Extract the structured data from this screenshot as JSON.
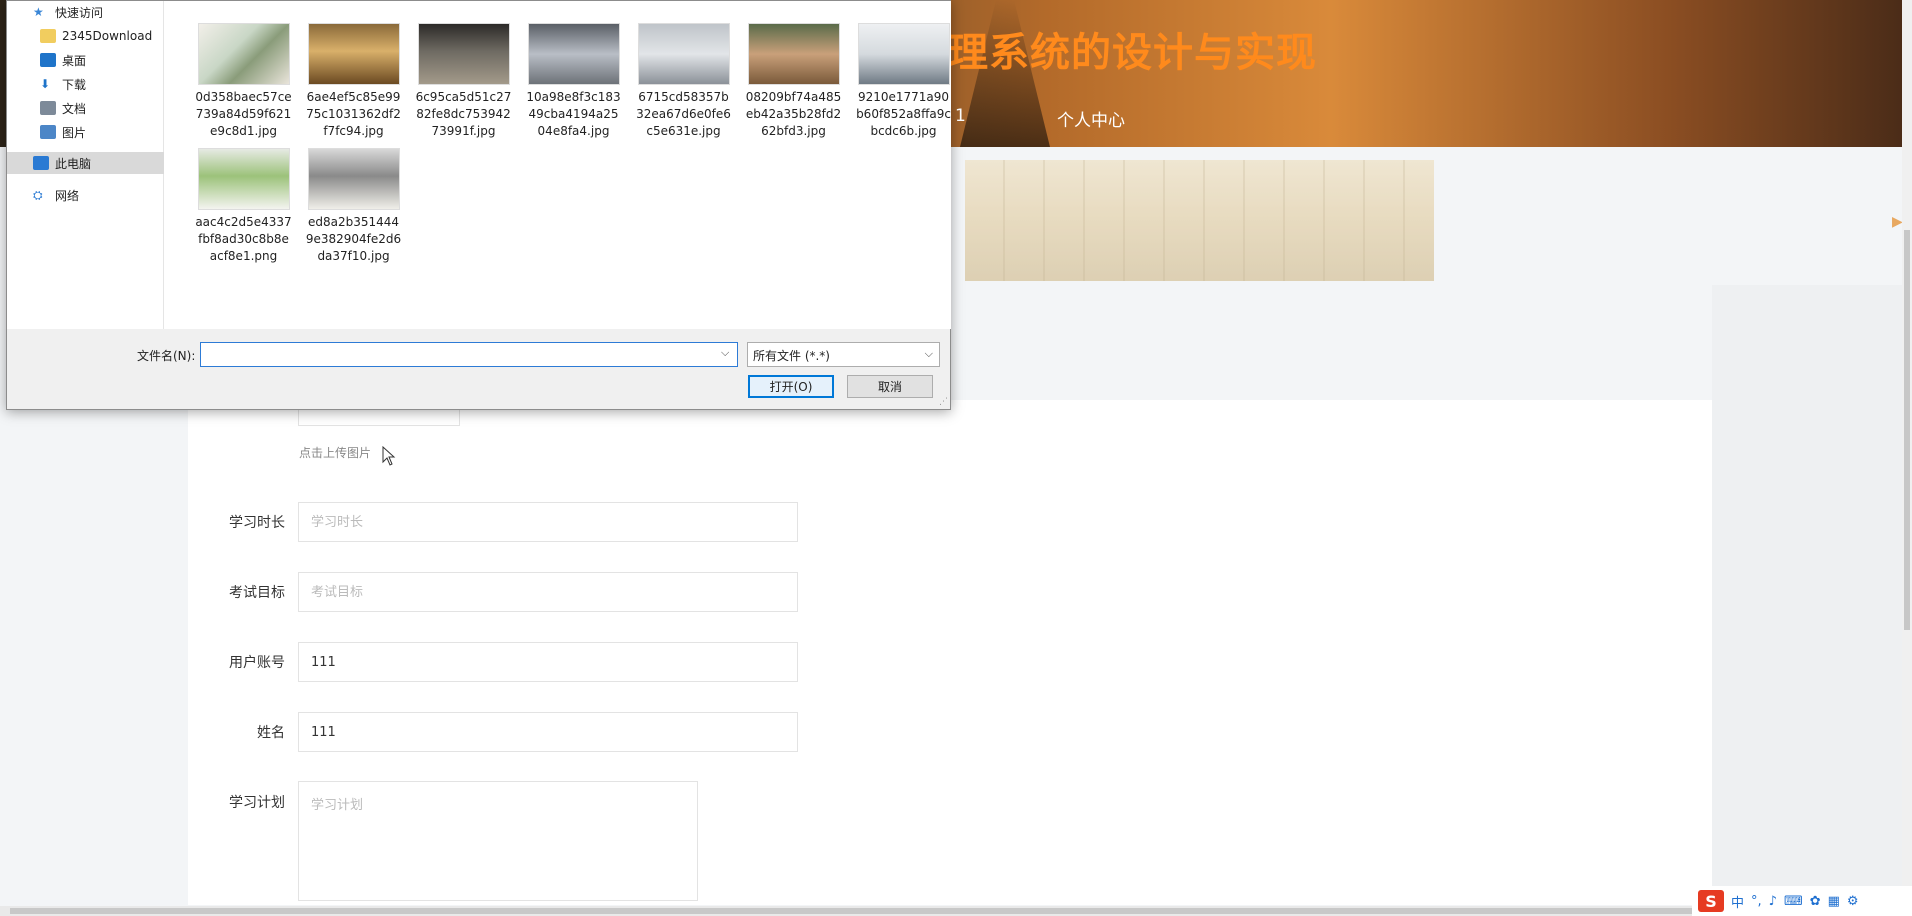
{
  "page": {
    "site_title": "理系统的设计与实现",
    "nav_partial": "1",
    "nav_user_center": "个人中心",
    "upload_hint": "点击上传图片",
    "form": {
      "study_duration": {
        "label": "学习时长",
        "placeholder": "学习时长",
        "value": ""
      },
      "exam_goal": {
        "label": "考试目标",
        "placeholder": "考试目标",
        "value": ""
      },
      "account": {
        "label": "用户账号",
        "placeholder": "",
        "value": "111"
      },
      "name": {
        "label": "姓名",
        "placeholder": "",
        "value": "111"
      },
      "study_plan": {
        "label": "学习计划",
        "placeholder": "学习计划",
        "value": ""
      }
    }
  },
  "dialog": {
    "nav": [
      {
        "label": "快速访问",
        "icon": "star-icon",
        "pinned": false
      },
      {
        "label": "2345Download",
        "icon": "folder-icon",
        "pinned": true
      },
      {
        "label": "桌面",
        "icon": "desktop-icon",
        "pinned": true
      },
      {
        "label": "下载",
        "icon": "download-icon",
        "pinned": true
      },
      {
        "label": "文档",
        "icon": "document-icon",
        "pinned": true
      },
      {
        "label": "图片",
        "icon": "pictures-icon",
        "pinned": true
      },
      {
        "label": "此电脑",
        "icon": "computer-icon",
        "pinned": false
      },
      {
        "label": "网络",
        "icon": "network-icon",
        "pinned": false
      }
    ],
    "files": [
      {
        "name": "0d358baec57ce739a84d59f621e9c8d1.jpg"
      },
      {
        "name": "6ae4ef5c85e9975c1031362df2f7fc94.jpg"
      },
      {
        "name": "6c95ca5d51c2782fe8dc75394273991f.jpg"
      },
      {
        "name": "10a98e8f3c18349cba4194a2504e8fa4.jpg"
      },
      {
        "name": "6715cd58357b32ea67d6e0fe6c5e631e.jpg"
      },
      {
        "name": "08209bf74a485eb42a35b28fd262bfd3.jpg"
      },
      {
        "name": "9210e1771a90b60f852a8ffa9cbcdc6b.jpg"
      },
      {
        "name": "aac4c2d5e4337fbf8ad30c8b8eacf8e1.png"
      },
      {
        "name": "ed8a2b3514449e382904fe2d6da37f10.jpg"
      }
    ],
    "filename_label": "文件名(N):",
    "filename_value": "",
    "filetype_selected": "所有文件 (*.*)",
    "open_button": "打开(O)",
    "cancel_button": "取消"
  },
  "ime": {
    "mode": "中"
  },
  "colors": {
    "title_orange": "#ff8a1c",
    "focus_blue": "#0078d7"
  }
}
